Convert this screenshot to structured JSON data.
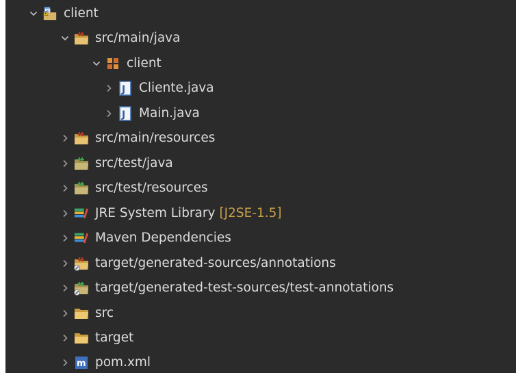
{
  "tree": {
    "items": [
      {
        "label": "client",
        "decoration": "",
        "expanded": true,
        "level": 0,
        "icon": "maven-project-icon"
      },
      {
        "label": "src/main/java",
        "decoration": "",
        "expanded": true,
        "level": 1,
        "icon": "source-folder-icon"
      },
      {
        "label": "client",
        "decoration": "",
        "expanded": true,
        "level": 2,
        "icon": "package-icon"
      },
      {
        "label": "Cliente.java",
        "decoration": "",
        "expanded": false,
        "level": 3,
        "icon": "java-file-icon"
      },
      {
        "label": "Main.java",
        "decoration": "",
        "expanded": false,
        "level": 3,
        "icon": "java-file-icon"
      },
      {
        "label": "src/main/resources",
        "decoration": "",
        "expanded": false,
        "level": 1,
        "icon": "source-folder-icon"
      },
      {
        "label": "src/test/java",
        "decoration": "",
        "expanded": false,
        "level": 1,
        "icon": "test-source-folder-icon"
      },
      {
        "label": "src/test/resources",
        "decoration": "",
        "expanded": false,
        "level": 1,
        "icon": "test-source-folder-icon"
      },
      {
        "label": "JRE System Library",
        "decoration": "[J2SE-1.5]",
        "expanded": false,
        "level": 1,
        "icon": "library-icon"
      },
      {
        "label": "Maven Dependencies",
        "decoration": "",
        "expanded": false,
        "level": 1,
        "icon": "library-icon"
      },
      {
        "label": "target/generated-sources/annotations",
        "decoration": "",
        "expanded": false,
        "level": 1,
        "icon": "generated-source-folder-icon"
      },
      {
        "label": "target/generated-test-sources/test-annotations",
        "decoration": "",
        "expanded": false,
        "level": 1,
        "icon": "generated-test-source-folder-icon"
      },
      {
        "label": "src",
        "decoration": "",
        "expanded": false,
        "level": 1,
        "icon": "folder-icon"
      },
      {
        "label": "target",
        "decoration": "",
        "expanded": false,
        "level": 1,
        "icon": "folder-icon"
      },
      {
        "label": "pom.xml",
        "decoration": "",
        "expanded": false,
        "level": 1,
        "icon": "maven-pom-icon"
      }
    ]
  },
  "colors": {
    "background": "#2b2b2b",
    "text": "#dcdcdc",
    "decoration": "#c8a04a",
    "chevron": "#b8b8b8"
  }
}
